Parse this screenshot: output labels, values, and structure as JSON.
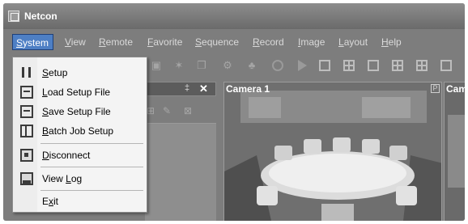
{
  "window": {
    "title": "Netcon"
  },
  "menubar": {
    "items": [
      {
        "first": "S",
        "rest": "ystem"
      },
      {
        "first": "V",
        "rest": "iew"
      },
      {
        "first": "R",
        "rest": "emote"
      },
      {
        "first": "F",
        "rest": "avorite"
      },
      {
        "first": "S",
        "rest": "equence"
      },
      {
        "first": "R",
        "rest": "ecord"
      },
      {
        "first": "I",
        "rest": "mage"
      },
      {
        "first": "L",
        "rest": "ayout"
      },
      {
        "first": "H",
        "rest": "elp"
      }
    ]
  },
  "system_menu": {
    "items": [
      {
        "key": "S",
        "rest": "etup",
        "icon": "setup-icon"
      },
      {
        "key": "L",
        "rest": "oad Setup File",
        "icon": "load-setup-file-icon"
      },
      {
        "key": "S",
        "rest": "ave Setup File",
        "icon": "save-setup-file-icon"
      },
      {
        "key": "B",
        "rest": "atch Job Setup",
        "icon": "batch-job-setup-icon"
      },
      {
        "key": "D",
        "rest": "isconnect",
        "icon": "disconnect-icon"
      },
      {
        "pre": "View ",
        "key": "L",
        "rest": "og",
        "icon": "view-log-icon"
      },
      {
        "pre": "E",
        "key": "x",
        "rest": "it"
      }
    ]
  },
  "panel": {
    "pin_glyph": "‡",
    "close_glyph": "✕"
  },
  "cameras": [
    {
      "label": "Camera 1",
      "badge": "P"
    },
    {
      "label": "Came"
    }
  ]
}
